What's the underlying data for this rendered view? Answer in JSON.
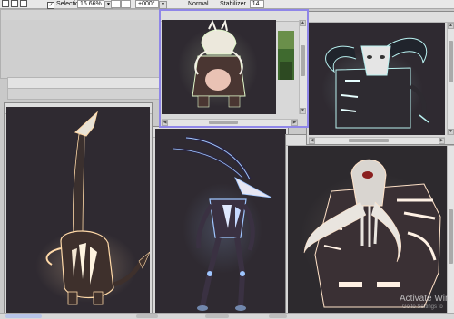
{
  "toolbar": {
    "selection_label": "Selection",
    "zoom_value": "16.66%",
    "rotation_value": "+000°",
    "blend_mode": "Normal",
    "stabilizer_label": "Stabilizer",
    "stabilizer_value": "14"
  },
  "windows": {
    "top_ghost": {
      "title": ""
    },
    "middle_ghost": {
      "title": ""
    },
    "small_active": {
      "title": ""
    },
    "top_right": {
      "title": ""
    },
    "left": {
      "title": ""
    },
    "center": {
      "title": ""
    },
    "bottom_right": {
      "title": ""
    }
  },
  "watermark": {
    "line1": "Activate Wind",
    "line2": "Go to Settings to"
  },
  "colors": {
    "canvas_bg": "#2f2a31",
    "active_border": "#8f86e8",
    "glow_warm": "#ffd9a8",
    "glow_blue": "#9fc6ff",
    "glow_green": "#dff6c8",
    "glow_teal": "#b9f1f0"
  },
  "icons": [
    "checkbox-icon",
    "dropdown-arrow-icon",
    "scroll-up-icon",
    "scroll-down-icon",
    "scroll-left-icon",
    "scroll-right-icon"
  ]
}
